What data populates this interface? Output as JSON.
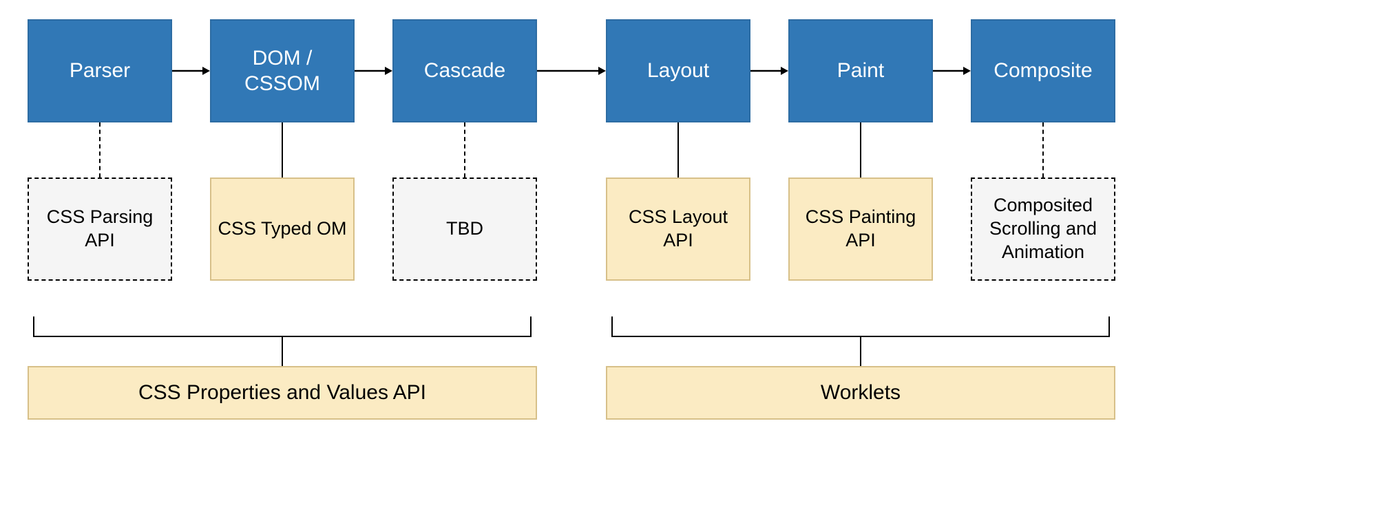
{
  "stages": {
    "parser": "Parser",
    "dom_cssom": "DOM /\nCSSOM",
    "cascade": "Cascade",
    "layout": "Layout",
    "paint": "Paint",
    "composite": "Composite"
  },
  "apis": {
    "css_parsing": "CSS Parsing API",
    "css_typed_om": "CSS Typed OM",
    "tbd": "TBD",
    "css_layout": "CSS Layout API",
    "css_painting": "CSS Painting API",
    "composited_scrolling": "Composited Scrolling and Animation"
  },
  "bottom": {
    "props_values": "CSS Properties and Values API",
    "worklets": "Worklets"
  }
}
